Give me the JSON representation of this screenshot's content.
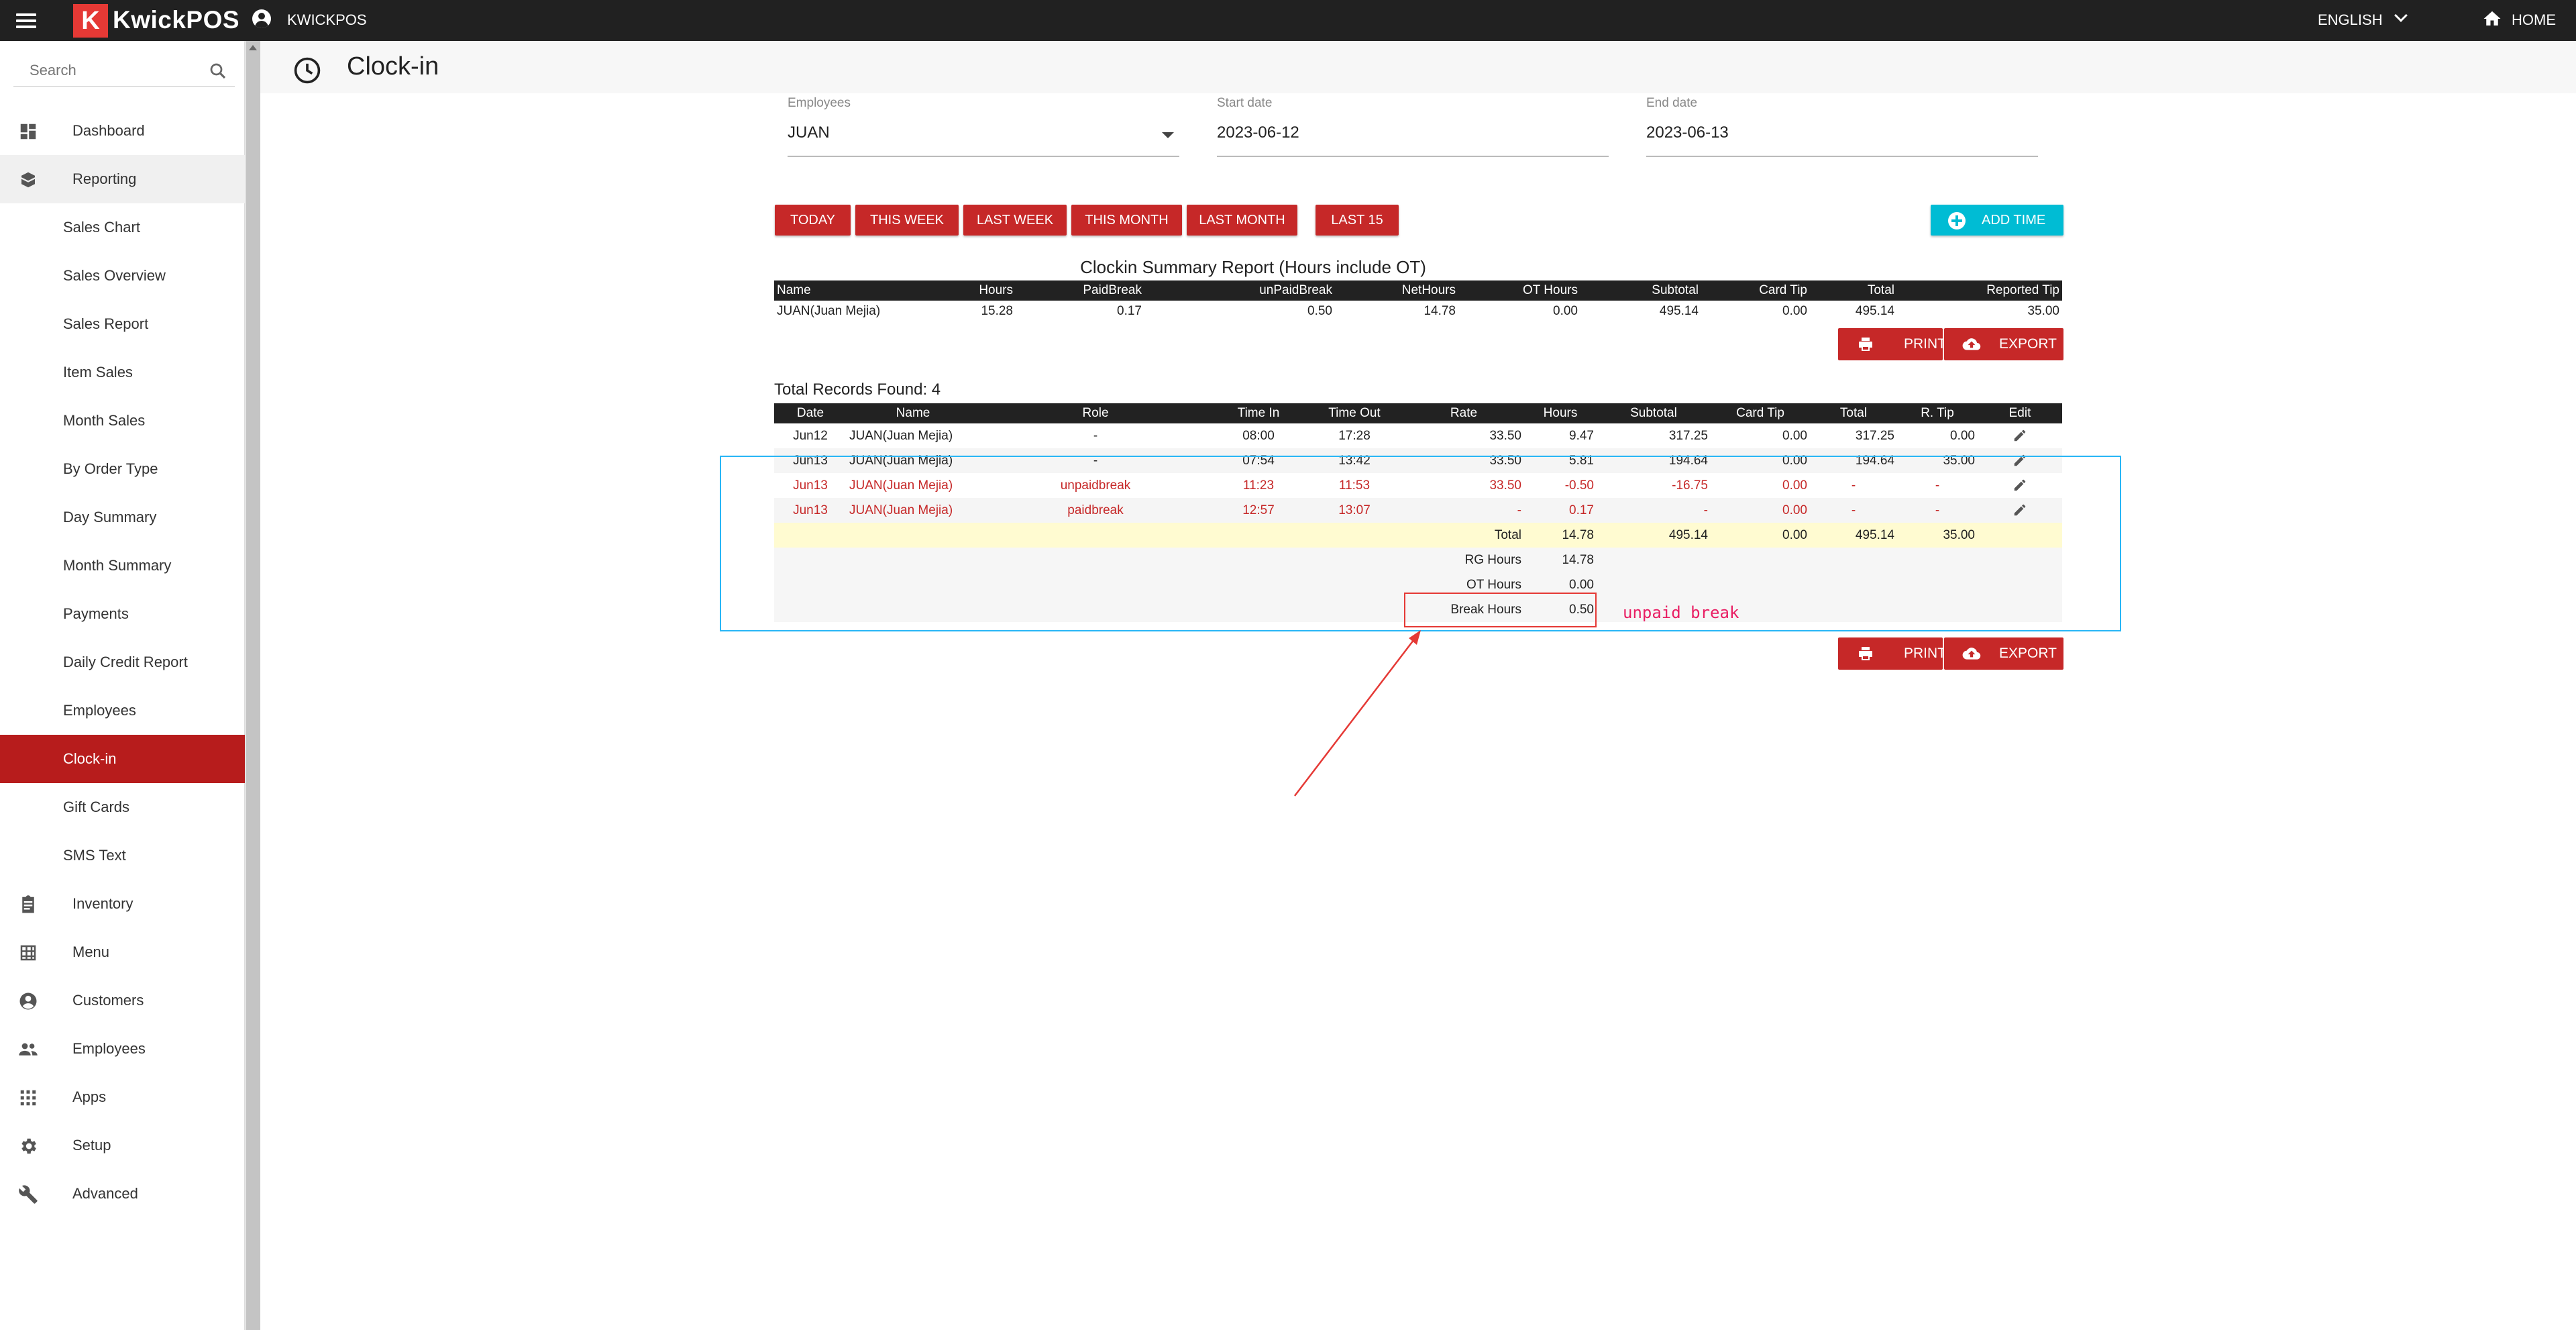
{
  "topbar": {
    "logo_letter": "K",
    "logo_text": "KwickPOS",
    "store_name": "KWICKPOS",
    "language": "ENGLISH",
    "home_label": "HOME"
  },
  "sidebar": {
    "search_placeholder": "Search",
    "items": [
      {
        "label": "Dashboard",
        "icon": "dashboard-icon"
      },
      {
        "label": "Reporting",
        "icon": "reporting-icon"
      },
      {
        "label": "Sales Chart"
      },
      {
        "label": "Sales Overview"
      },
      {
        "label": "Sales Report"
      },
      {
        "label": "Item Sales"
      },
      {
        "label": "Month Sales"
      },
      {
        "label": "By Order Type"
      },
      {
        "label": "Day Summary"
      },
      {
        "label": "Month Summary"
      },
      {
        "label": "Payments"
      },
      {
        "label": "Daily Credit Report"
      },
      {
        "label": "Employees"
      },
      {
        "label": "Clock-in"
      },
      {
        "label": "Gift Cards"
      },
      {
        "label": "SMS Text"
      },
      {
        "label": "Inventory",
        "icon": "clipboard-icon"
      },
      {
        "label": "Menu",
        "icon": "grid-icon"
      },
      {
        "label": "Customers",
        "icon": "account-icon"
      },
      {
        "label": "Employees",
        "icon": "people-icon"
      },
      {
        "label": "Apps",
        "icon": "apps-icon"
      },
      {
        "label": "Setup",
        "icon": "gear-icon"
      },
      {
        "label": "Advanced",
        "icon": "wrench-icon"
      }
    ],
    "active_item": "Clock-in"
  },
  "page": {
    "title": "Clock-in"
  },
  "filters": {
    "employees_label": "Employees",
    "employees_value": "JUAN",
    "start_label": "Start date",
    "start_value": "2023-06-12",
    "end_label": "End date",
    "end_value": "2023-06-13"
  },
  "range_buttons": [
    "TODAY",
    "THIS WEEK",
    "LAST WEEK",
    "THIS MONTH",
    "LAST MONTH",
    "LAST 15"
  ],
  "add_time_label": "ADD TIME",
  "summary": {
    "title": "Clockin Summary Report (Hours include OT)",
    "headers": [
      "Name",
      "Hours",
      "PaidBreak",
      "unPaidBreak",
      "NetHours",
      "OT Hours",
      "Subtotal",
      "Card Tip",
      "Total",
      "Reported Tip"
    ],
    "row": [
      "JUAN(Juan Mejia)",
      "15.28",
      "0.17",
      "0.50",
      "14.78",
      "0.00",
      "495.14",
      "0.00",
      "495.14",
      "35.00"
    ]
  },
  "print_label": "PRINT",
  "export_label": "EXPORT",
  "records": {
    "found_text": "Total Records Found: 4",
    "headers": [
      "Date",
      "Name",
      "Role",
      "Time In",
      "Time Out",
      "Rate",
      "Hours",
      "Subtotal",
      "Card Tip",
      "Total",
      "R. Tip",
      "Edit"
    ],
    "rows": [
      [
        "Jun12",
        "JUAN(Juan Mejia)",
        "-",
        "08:00",
        "17:28",
        "33.50",
        "9.47",
        "317.25",
        "0.00",
        "317.25",
        "0.00"
      ],
      [
        "Jun13",
        "JUAN(Juan Mejia)",
        "-",
        "07:54",
        "13:42",
        "33.50",
        "5.81",
        "194.64",
        "0.00",
        "194.64",
        "35.00"
      ],
      [
        "Jun13",
        "JUAN(Juan Mejia)",
        "unpaidbreak",
        "11:23",
        "11:53",
        "33.50",
        "-0.50",
        "-16.75",
        "0.00",
        "-",
        "-"
      ],
      [
        "Jun13",
        "JUAN(Juan Mejia)",
        "paidbreak",
        "12:57",
        "13:07",
        "-",
        "0.17",
        "-",
        "0.00",
        "-",
        "-"
      ]
    ],
    "total_label": "Total",
    "total_values": [
      "14.78",
      "495.14",
      "0.00",
      "495.14",
      "35.00"
    ],
    "rg_label": "RG Hours",
    "rg_value": "14.78",
    "ot_label": "OT Hours",
    "ot_value": "0.00",
    "break_label": "Break Hours",
    "break_value": "0.50"
  },
  "annotation": {
    "note": "unpaid break",
    "box_color": "#e53935",
    "highlight_color": "#29b6f6"
  },
  "colors": {
    "topbar": "#212121",
    "brand_red": "#c62828",
    "active_nav": "#b71c1c",
    "add_time": "#00bcd4"
  }
}
